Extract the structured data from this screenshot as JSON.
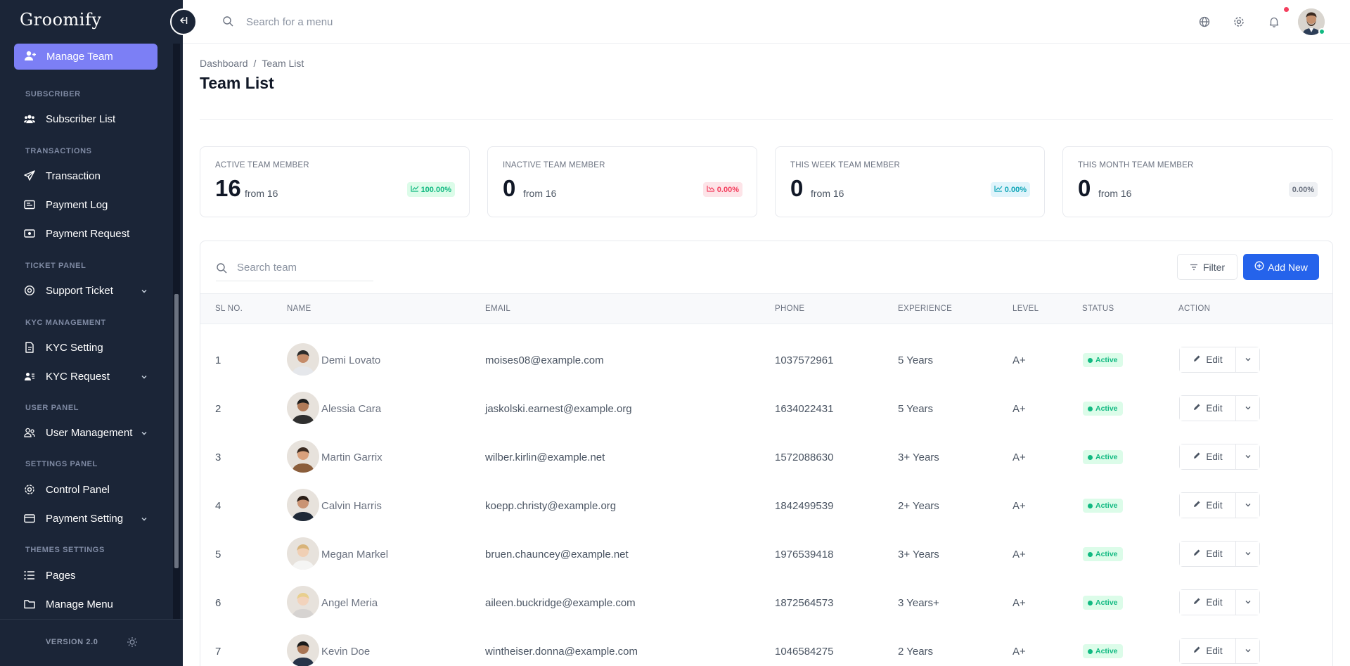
{
  "brand": {
    "logo": "Groomify"
  },
  "sidebar": {
    "active": {
      "label": "Manage Team",
      "icon": "user-plus-icon"
    },
    "sections": [
      {
        "title": "SUBSCRIBER"
      },
      {
        "title": "TRANSACTIONS"
      },
      {
        "title": "TICKET PANEL"
      },
      {
        "title": "KYC MANAGEMENT"
      },
      {
        "title": "USER PANEL"
      },
      {
        "title": "SETTINGS PANEL"
      },
      {
        "title": "THEMES SETTINGS"
      }
    ],
    "items": [
      {
        "label": "Subscriber List",
        "icon": "users-icon"
      },
      {
        "label": "Transaction",
        "icon": "send-icon"
      },
      {
        "label": "Payment Log",
        "icon": "receipt-icon"
      },
      {
        "label": "Payment Request",
        "icon": "cash-icon"
      },
      {
        "label": "Support Ticket",
        "icon": "support-icon"
      },
      {
        "label": "KYC Setting",
        "icon": "document-icon"
      },
      {
        "label": "KYC Request",
        "icon": "id-card-icon"
      },
      {
        "label": "User Management",
        "icon": "users-gear-icon"
      },
      {
        "label": "Control Panel",
        "icon": "gear-icon"
      },
      {
        "label": "Payment Setting",
        "icon": "wallet-icon"
      },
      {
        "label": "Pages",
        "icon": "list-icon"
      },
      {
        "label": "Manage Menu",
        "icon": "folder-icon"
      }
    ],
    "version": "VERSION 2.0"
  },
  "topbar": {
    "search_placeholder": "Search for a menu"
  },
  "breadcrumb": {
    "home": "Dashboard",
    "separator": "/",
    "current": "Team List"
  },
  "page_title": "Team List",
  "stats": [
    {
      "label": "ACTIVE TEAM MEMBER",
      "value": "16",
      "from": "from 16",
      "change": "100.00%",
      "trend": "up",
      "color": "#10b981"
    },
    {
      "label": "INACTIVE TEAM MEMBER",
      "value": "0",
      "from": "from 16",
      "change": "0.00%",
      "trend": "down",
      "color": "#f43f5e"
    },
    {
      "label": "THIS WEEK TEAM MEMBER",
      "value": "0",
      "from": "from 16",
      "change": "0.00%",
      "trend": "up",
      "color": "#0ea5b7"
    },
    {
      "label": "THIS MONTH TEAM MEMBER",
      "value": "0",
      "from": "from 16",
      "change": "0.00%",
      "trend": "none",
      "color": "#6b7280"
    }
  ],
  "team": {
    "search_placeholder": "Search team",
    "filter_label": "Filter",
    "add_label": "Add New",
    "columns": [
      "SL NO.",
      "NAME",
      "EMAIL",
      "PHONE",
      "EXPERIENCE",
      "LEVEL",
      "STATUS",
      "ACTION"
    ],
    "edit_label": "Edit",
    "rows": [
      {
        "sl": "1",
        "name": "Demi Lovato",
        "email": "moises08@example.com",
        "phone": "1037572961",
        "experience": "5 Years",
        "level": "A+",
        "status": "Active"
      },
      {
        "sl": "2",
        "name": "Alessia Cara",
        "email": "jaskolski.earnest@example.org",
        "phone": "1634022431",
        "experience": "5 Years",
        "level": "A+",
        "status": "Active"
      },
      {
        "sl": "3",
        "name": "Martin Garrix",
        "email": "wilber.kirlin@example.net",
        "phone": "1572088630",
        "experience": "3+ Years",
        "level": "A+",
        "status": "Active"
      },
      {
        "sl": "4",
        "name": "Calvin Harris",
        "email": "koepp.christy@example.org",
        "phone": "1842499539",
        "experience": "2+ Years",
        "level": "A+",
        "status": "Active"
      },
      {
        "sl": "5",
        "name": "Megan Markel",
        "email": "bruen.chauncey@example.net",
        "phone": "1976539418",
        "experience": "3+ Years",
        "level": "A+",
        "status": "Active"
      },
      {
        "sl": "6",
        "name": "Angel Meria",
        "email": "aileen.buckridge@example.com",
        "phone": "1872564573",
        "experience": "3 Years+",
        "level": "A+",
        "status": "Active"
      },
      {
        "sl": "7",
        "name": "Kevin Doe",
        "email": "wintheiser.donna@example.com",
        "phone": "1046584275",
        "experience": "2 Years",
        "level": "A+",
        "status": "Active"
      }
    ]
  },
  "colors": {
    "sidebar_bg": "#1b2537",
    "active_nav": "#7c7ff5",
    "primary": "#2563eb",
    "success": "#10b981",
    "danger": "#f43f5e"
  }
}
